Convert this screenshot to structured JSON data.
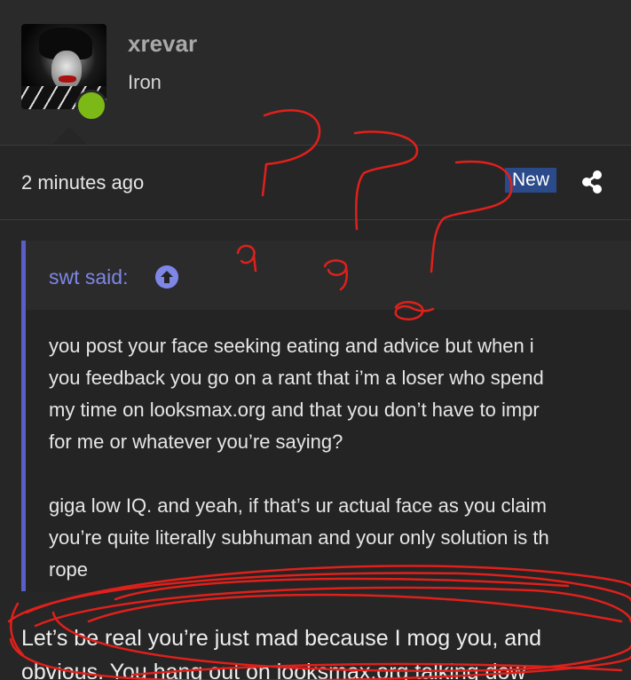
{
  "user": {
    "name": "xrevar",
    "title": "Iron"
  },
  "post": {
    "timestamp": "2 minutes ago",
    "badge": "New",
    "share_icon": "share-icon"
  },
  "quote": {
    "author": "swt said:",
    "jump_icon": "arrow-up-circle-icon",
    "text": "you post your face seeking eating and advice but when i\nyou feedback you go on a rant that i’m a loser who spend\nmy time on looksmax.org and that you don’t have to impr\nfor me or whatever you’re saying?\n\ngiga low IQ. and yeah, if that’s ur actual face as you claim\nyou’re quite literally subhuman and your only solution is th\nrope"
  },
  "reply": {
    "text": "Let’s be real you’re just mad because I mog you, and\nobvious. You hang out on looksmax.org talking dow"
  },
  "colors": {
    "background": "#262626",
    "quote_accent": "#5a5ec6",
    "badge": "#2b4a8a",
    "online": "#7cb916",
    "scribble": "#e0201b"
  }
}
